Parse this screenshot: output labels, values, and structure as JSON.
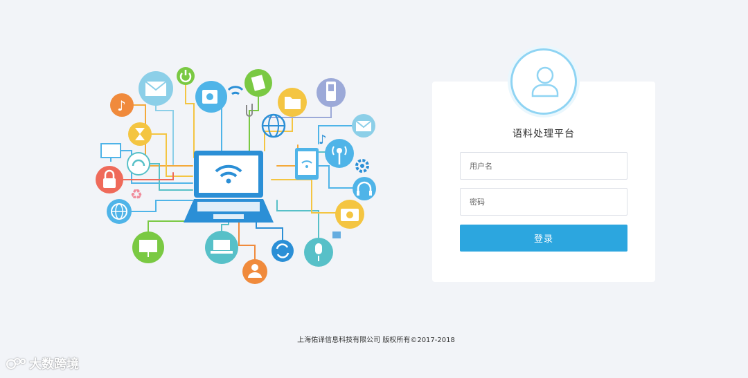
{
  "login": {
    "title": "语料处理平台",
    "username_placeholder": "用户名",
    "password_placeholder": "密码",
    "submit_label": "登录"
  },
  "footer": {
    "copyright": "上海佑译信息科技有限公司 版权所有©2017-2018"
  },
  "watermark": {
    "text": "大数跨境"
  },
  "colors": {
    "background": "#f2f4f8",
    "accent": "#2ca6df",
    "avatar_ring": "#8fd4f3",
    "laptop": "#2b8fd6"
  },
  "illustration": {
    "icons": [
      "music-note-icon",
      "mail-icon",
      "power-icon",
      "camera-icon",
      "wifi-icon",
      "document-icon",
      "folder-icon",
      "mobile-phone-icon",
      "hourglass-icon",
      "globe-icon",
      "monitor-icon",
      "headset-icon",
      "lock-icon",
      "recycle-icon",
      "laptop-wifi-icon",
      "tablet-wifi-icon",
      "broadcast-icon",
      "gear-icon",
      "headphones-icon",
      "photo-camera-icon",
      "sync-icon",
      "microphone-icon",
      "user-icon"
    ]
  }
}
